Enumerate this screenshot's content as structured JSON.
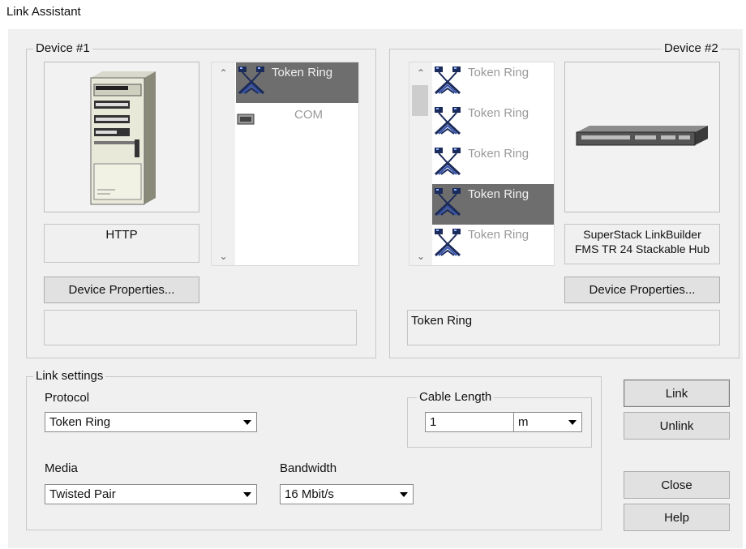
{
  "window": {
    "title": "Link Assistant"
  },
  "device1": {
    "legend": "Device #1",
    "name": "HTTP",
    "ports": [
      {
        "label": "Token Ring",
        "icon": "token-ring-icon",
        "selected": true
      },
      {
        "label": "COM",
        "icon": "serial-port-icon",
        "selected": false
      }
    ],
    "properties_label": "Device Properties...",
    "status": ""
  },
  "device2": {
    "legend": "Device #2",
    "name": "SuperStack LinkBuilder FMS TR 24 Stackable Hub",
    "ports": [
      {
        "label": "Token Ring",
        "icon": "token-ring-icon",
        "selected": false
      },
      {
        "label": "Token Ring",
        "icon": "token-ring-icon",
        "selected": false
      },
      {
        "label": "Token Ring",
        "icon": "token-ring-icon",
        "selected": false
      },
      {
        "label": "Token Ring",
        "icon": "token-ring-icon",
        "selected": true
      },
      {
        "label": "Token Ring",
        "icon": "token-ring-icon",
        "selected": false
      }
    ],
    "properties_label": "Device Properties...",
    "status": "Token Ring"
  },
  "link_settings": {
    "legend": "Link settings",
    "protocol_label": "Protocol",
    "protocol_value": "Token Ring",
    "cable_length_legend": "Cable Length",
    "cable_length_value": "1",
    "cable_unit": "m",
    "media_label": "Media",
    "media_value": "Twisted Pair",
    "bandwidth_label": "Bandwidth",
    "bandwidth_value": "16 Mbit/s"
  },
  "buttons": {
    "link": "Link",
    "unlink": "Unlink",
    "close": "Close",
    "help": "Help"
  }
}
